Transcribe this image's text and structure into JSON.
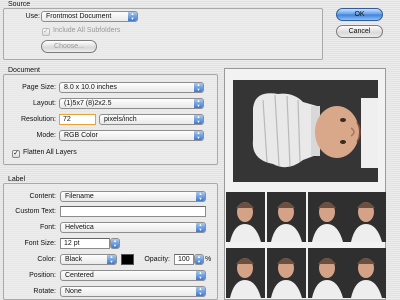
{
  "source": {
    "title": "Source",
    "use_label": "Use:",
    "use_value": "Frontmost Document",
    "include_subfolders_label": "Include All Subfolders",
    "include_subfolders_checked": true,
    "choose_label": "Choose..."
  },
  "buttons": {
    "ok": "OK",
    "cancel": "Cancel"
  },
  "document": {
    "title": "Document",
    "page_size_label": "Page Size:",
    "page_size_value": "8.0 x 10.0 inches",
    "layout_label": "Layout:",
    "layout_value": "(1)5x7 (8)2x2.5",
    "resolution_label": "Resolution:",
    "resolution_value": "72",
    "resolution_unit": "pixels/inch",
    "mode_label": "Mode:",
    "mode_value": "RGB Color",
    "flatten_label": "Flatten All Layers",
    "flatten_checked": true
  },
  "label": {
    "title": "Label",
    "content_label": "Content:",
    "content_value": "Filename",
    "custom_text_label": "Custom Text:",
    "custom_text_value": "",
    "font_label": "Font:",
    "font_value": "Helvetica",
    "font_size_label": "Font Size:",
    "font_size_value": "12 pt",
    "color_label": "Color:",
    "color_value": "Black",
    "color_swatch": "#000000",
    "opacity_label": "Opacity:",
    "opacity_value": "100",
    "opacity_unit": "%",
    "position_label": "Position:",
    "position_value": "Centered",
    "rotate_label": "Rotate:",
    "rotate_value": "None"
  },
  "colors": {
    "accent_blue": "#3b80d8",
    "photo_bg": "#2f2f2f"
  }
}
